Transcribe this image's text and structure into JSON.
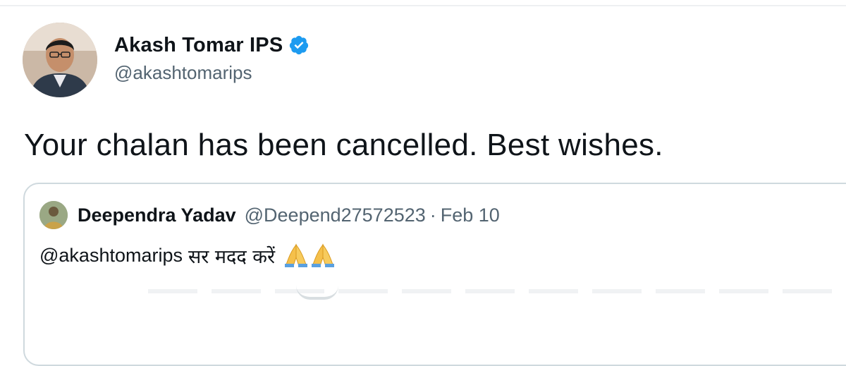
{
  "author": {
    "display_name": "Akash Tomar IPS",
    "handle": "@akashtomarips",
    "verified": true,
    "avatar_icon": "user-photo"
  },
  "tweet": {
    "text": "Your chalan has been cancelled. Best wishes."
  },
  "quoted_tweet": {
    "display_name": "Deependra Yadav",
    "handle": "@Deepend27572523",
    "separator": "·",
    "date": "Feb 10",
    "mention": "@akashtomarips",
    "text": "सर मदद करें",
    "emoji": "folded-hands x2"
  },
  "colors": {
    "text": "#0f1419",
    "secondary": "#536471",
    "verified_blue": "#1d9bf0",
    "border": "#cfd9de"
  }
}
